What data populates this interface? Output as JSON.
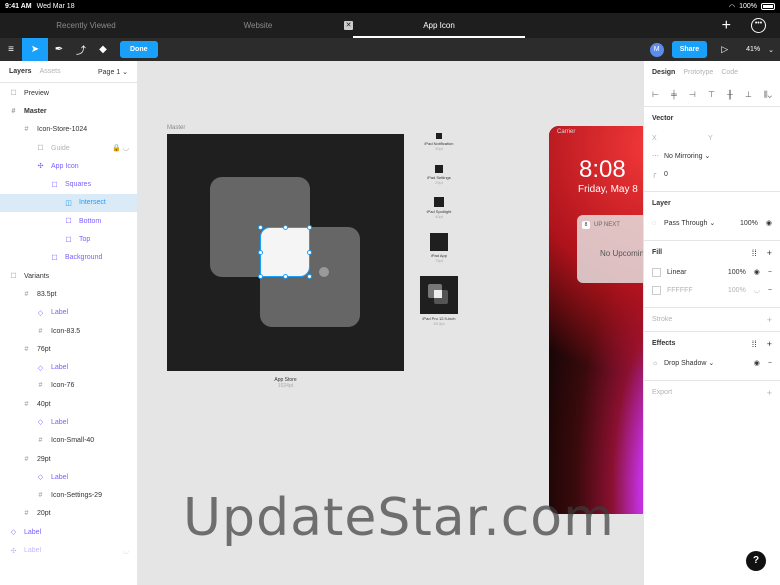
{
  "statusbar": {
    "time": "9:41 AM",
    "date": "Wed Mar 18",
    "battery": "100%"
  },
  "tabs": [
    {
      "label": "Recently Viewed"
    },
    {
      "label": "Website"
    },
    {
      "label": "App Icon"
    }
  ],
  "toolbar": {
    "done_label": "Done",
    "avatar_letter": "M",
    "share_label": "Share",
    "zoom": "41%"
  },
  "left_panel": {
    "tabs": {
      "layers": "Layers",
      "assets": "Assets"
    },
    "page": "Page 1 ⌄",
    "layers": [
      {
        "label": "Preview"
      },
      {
        "label": "Master"
      },
      {
        "label": "Icon-Store-1024"
      },
      {
        "label": "Guide"
      },
      {
        "label": "App Icon"
      },
      {
        "label": "Squares"
      },
      {
        "label": "Intersect"
      },
      {
        "label": "Bottom"
      },
      {
        "label": "Top"
      },
      {
        "label": "Background"
      },
      {
        "label": "Variants"
      },
      {
        "label": "83.5pt"
      },
      {
        "label": "Label"
      },
      {
        "label": "Icon-83.5"
      },
      {
        "label": "76pt"
      },
      {
        "label": "Label"
      },
      {
        "label": "Icon-76"
      },
      {
        "label": "40pt"
      },
      {
        "label": "Label"
      },
      {
        "label": "Icon-Small-40"
      },
      {
        "label": "29pt"
      },
      {
        "label": "Label"
      },
      {
        "label": "Icon-Settings-29"
      },
      {
        "label": "20pt"
      },
      {
        "label": "Label"
      },
      {
        "label": "Label"
      }
    ]
  },
  "canvas": {
    "master_label": "Master",
    "carrier": "Carrier",
    "app_store": {
      "title": "App Store",
      "sub": "1024pt"
    },
    "minis": [
      {
        "title": "iPad Notification",
        "sub": "20pt"
      },
      {
        "title": "iPad Settings",
        "sub": "29pt"
      },
      {
        "title": "iPad Spotlight",
        "sub": "40pt"
      },
      {
        "title": "iPad App",
        "sub": "76pt"
      },
      {
        "title": "iPad Pro 12.9-inch",
        "sub": "83.5pt"
      }
    ],
    "lock_time": "8:08",
    "lock_date": "Friday, May 8",
    "notif_badge": "8",
    "notif_title": "UP NEXT",
    "notif_body": "No Upcoming"
  },
  "right_panel": {
    "tabs": {
      "design": "Design",
      "prototype": "Prototype",
      "code": "Code"
    },
    "vector": {
      "title": "Vector",
      "x": "X",
      "y": "Y",
      "mirroring": "No Mirroring ⌄",
      "radius": "0"
    },
    "layer": {
      "title": "Layer",
      "blend": "Pass Through ⌄",
      "opacity": "100%"
    },
    "fill": {
      "title": "Fill",
      "rows": [
        {
          "name": "Linear",
          "opacity": "100%"
        },
        {
          "name": "FFFFFF",
          "opacity": "100%"
        }
      ]
    },
    "stroke": {
      "title": "Stroke"
    },
    "effects": {
      "title": "Effects",
      "item": "Drop Shadow ⌄"
    },
    "export": {
      "title": "Export"
    }
  },
  "watermark": "UpdateStar.com",
  "help": "?",
  "colors": {
    "accent": "#18a0fb",
    "component": "#7b61ff",
    "toolbar": "#2c2c2c",
    "tabbar": "#1e1e1e"
  }
}
